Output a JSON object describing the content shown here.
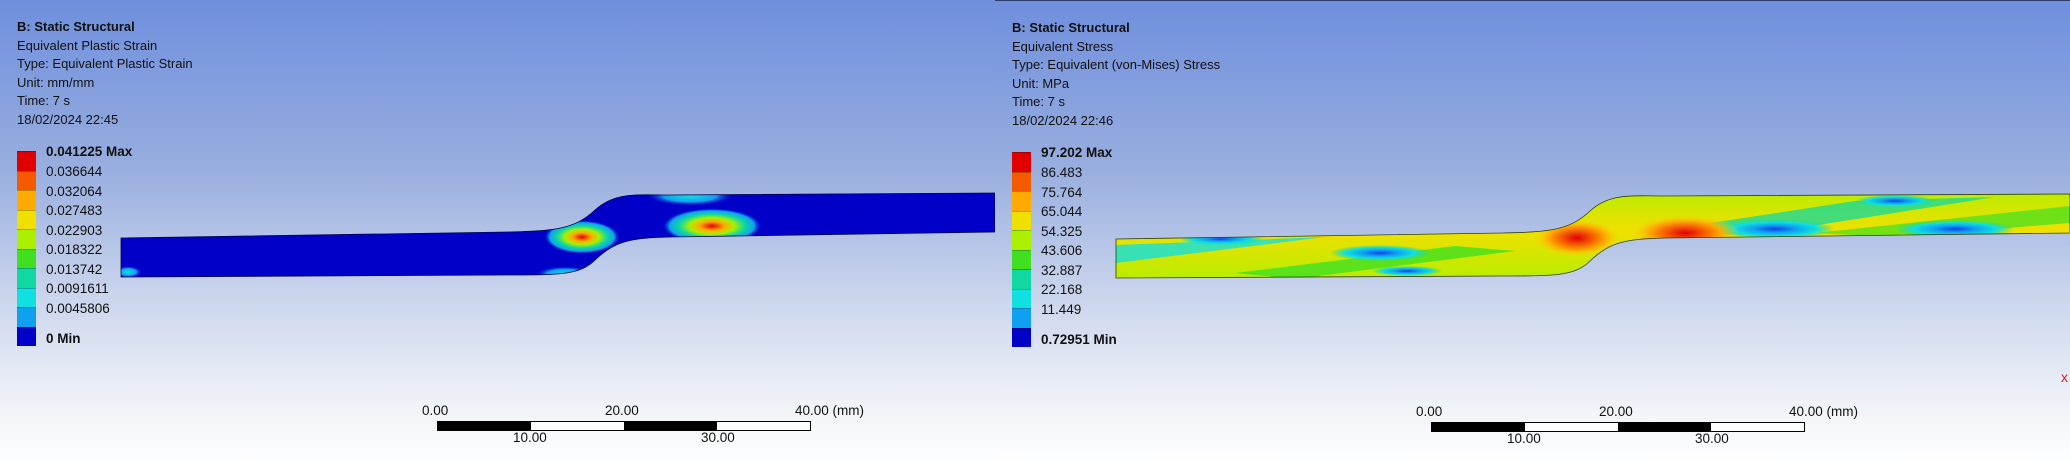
{
  "panels": [
    {
      "id": "left",
      "title": "B: Static Structural",
      "result_name": "Equivalent Plastic Strain",
      "type_line": "Type: Equivalent Plastic Strain",
      "unit_line": "Unit: mm/mm",
      "time_line": "Time: 7 s",
      "date_line": "18/02/2024 22:45",
      "legend": {
        "max_label": "0.041225 Max",
        "min_label": "0 Min",
        "values": [
          "0.036644",
          "0.032064",
          "0.027483",
          "0.022903",
          "0.018322",
          "0.013742",
          "0.0091611",
          "0.0045806"
        ]
      },
      "scale": {
        "top_labels": [
          "0.00",
          "20.00",
          "40.00 (mm)"
        ],
        "bottom_labels": [
          "10.00",
          "30.00"
        ]
      }
    },
    {
      "id": "right",
      "title": "B: Static Structural",
      "result_name": "Equivalent Stress",
      "type_line": "Type: Equivalent (von-Mises) Stress",
      "unit_line": "Unit: MPa",
      "time_line": "Time: 7 s",
      "date_line": "18/02/2024 22:46",
      "legend": {
        "max_label": "97.202 Max",
        "min_label": "0.72951 Min",
        "values": [
          "86.483",
          "75.764",
          "65.044",
          "54.325",
          "43.606",
          "32.887",
          "22.168",
          "11.449"
        ]
      },
      "scale": {
        "top_labels": [
          "0.00",
          "20.00",
          "40.00 (mm)"
        ],
        "bottom_labels": [
          "10.00",
          "30.00"
        ]
      }
    }
  ],
  "colormap": [
    "#e00000",
    "#f55a00",
    "#ffaa00",
    "#f0e000",
    "#aaf000",
    "#40e020",
    "#10d8a0",
    "#10e0e0",
    "#10a0f0",
    "#1040e8",
    "#0000c8"
  ],
  "triad_mark": "x"
}
